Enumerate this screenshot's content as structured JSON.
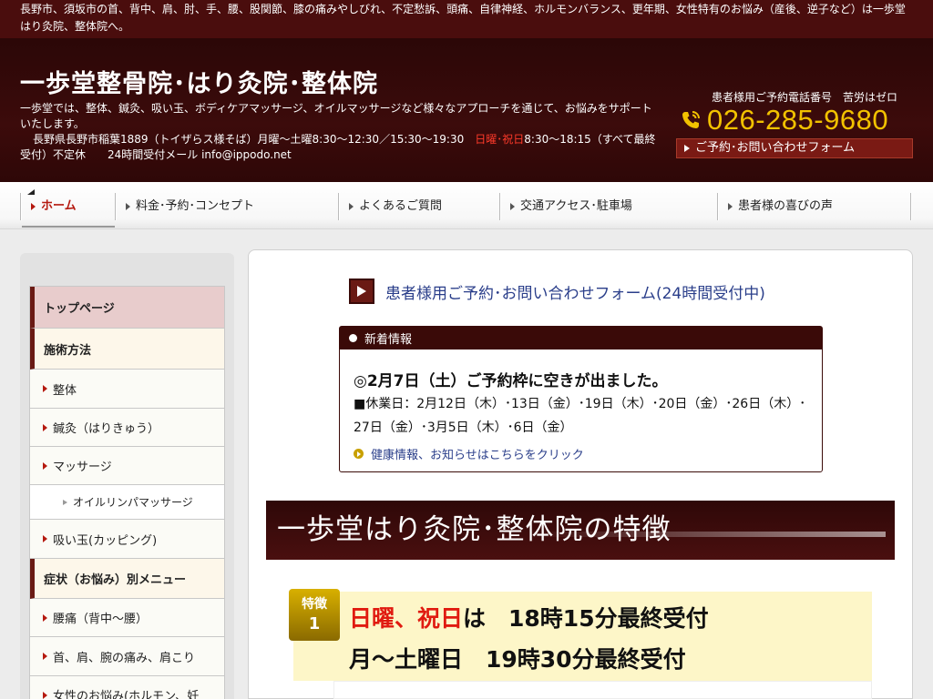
{
  "topbar": {
    "text": "長野市、須坂市の首、背中、肩、肘、手、腰、股関節、膝の痛みやしびれ、不定愁訴、頭痛、自律神経、ホルモンバランス、更年期、女性特有のお悩み（産後、逆子など）は一歩堂はり灸院、整体院へ。"
  },
  "header": {
    "site_title": "一歩堂整骨院･はり灸院･整体院",
    "description": "一歩堂では、整体、鍼灸、吸い玉、ボディケアマッサージ、オイルマッサージなど様々なアプローチを通じて、お悩みをサポートいたします。",
    "address_part1": "長野県長野市稲葉1889（トイザらス様そば）月曜～土曜8:30～12:30／15:30～19:30　",
    "address_red": "日曜･祝日",
    "address_part2": "8:30～18:15（すべて最終受付）不定休　　24時間受付メール info@ippodo.net",
    "tel_caption": "患者様用ご予約電話番号　苦労はゼロ",
    "tel_number": "026-285-9680",
    "form_button": "ご予約･お問い合わせフォーム"
  },
  "nav": {
    "items": [
      {
        "label": "ホーム",
        "active": true
      },
      {
        "label": "料金･予約･コンセプト",
        "active": false
      },
      {
        "label": "よくあるご質問",
        "active": false
      },
      {
        "label": "交通アクセス･駐車場",
        "active": false
      },
      {
        "label": "患者様の喜びの声",
        "active": false
      }
    ]
  },
  "sidebar": {
    "items": [
      {
        "label": "トップページ",
        "kind": "top"
      },
      {
        "label": "施術方法",
        "kind": "category"
      },
      {
        "label": "整体",
        "kind": "item"
      },
      {
        "label": "鍼灸（はりきゅう）",
        "kind": "item"
      },
      {
        "label": "マッサージ",
        "kind": "item"
      },
      {
        "label": "オイルリンパマッサージ",
        "kind": "sub"
      },
      {
        "label": "吸い玉(カッピング)",
        "kind": "item"
      },
      {
        "label": "症状（お悩み）別メニュー",
        "kind": "category"
      },
      {
        "label": "腰痛（背中～腰）",
        "kind": "item"
      },
      {
        "label": "首、肩、腕の痛み、肩こり",
        "kind": "item"
      },
      {
        "label": "女性のお悩み(ホルモン、妊",
        "kind": "item"
      }
    ]
  },
  "main": {
    "form_link": "患者様用ご予約･お問い合わせフォーム(24時間受付中)",
    "news": {
      "heading": "新着情報",
      "title": "◎2月7日（土）ご予約枠に空きが出ました。",
      "body": "■休業日：2月12日（木）･13日（金）･19日（木）･20日（金）･26日（木）･27日（金）･3月5日（木）･6日（金）",
      "link": "健康情報、お知らせはこちらをクリック"
    },
    "feature_banner": "一歩堂はり灸院･整体院の特徴",
    "feature1": {
      "badge_label": "特徴",
      "badge_number": "1",
      "line1_red": "日曜、祝日",
      "line1_rest": "は　18時15分最終受付",
      "line2": "月～土曜日　19時30分最終受付"
    }
  },
  "colors": {
    "header_bg": "#3c0b0b",
    "accent_red": "#b51a10",
    "tel_yellow": "#f2c200",
    "link_blue": "#2a3e8a",
    "feature_bg": "#fdf6c8"
  }
}
